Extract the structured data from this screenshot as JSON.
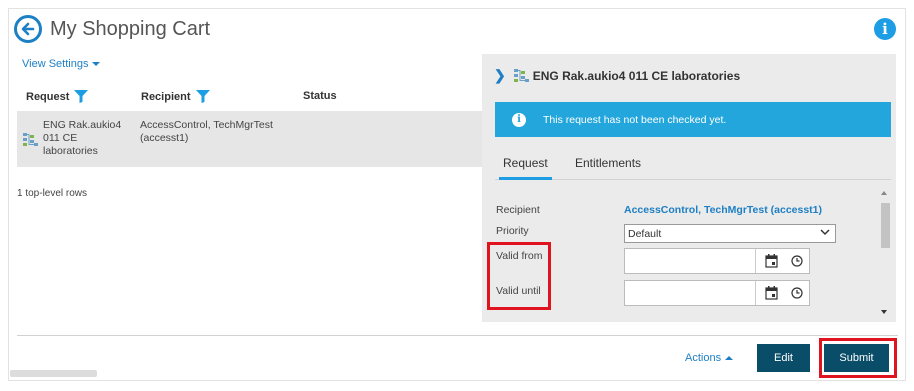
{
  "header": {
    "title": "My Shopping Cart"
  },
  "view_settings": {
    "label": "View Settings"
  },
  "table": {
    "columns": [
      "Request",
      "Recipient",
      "Status"
    ],
    "rows": [
      {
        "request": "ENG Rak.aukio4 011 CE laboratories",
        "recipient": "AccessControl, TechMgrTest (accesst1)",
        "status": ""
      }
    ],
    "row_count_text": "1 top-level rows"
  },
  "details": {
    "title": "ENG Rak.aukio4 011 CE laboratories",
    "notice": "This request has not been checked yet.",
    "tabs": [
      "Request",
      "Entitlements"
    ],
    "active_tab": "Request",
    "form": {
      "recipient_label": "Recipient",
      "recipient_value": "AccessControl, TechMgrTest (accesst1)",
      "priority_label": "Priority",
      "priority_value": "Default",
      "valid_from_label": "Valid from",
      "valid_from_value": "",
      "valid_until_label": "Valid until",
      "valid_until_value": ""
    }
  },
  "footer": {
    "actions_label": "Actions",
    "edit_label": "Edit",
    "submit_label": "Submit"
  },
  "colors": {
    "accent": "#1d7fc4",
    "notice_bg": "#23a6dc",
    "primary_button": "#0a4d68",
    "highlight_border": "#e0141e"
  },
  "icons": {
    "back": "arrow-left-circle-icon",
    "info": "info-icon",
    "filter": "funnel-icon",
    "item": "building-network-icon",
    "calendar": "calendar-icon",
    "clock": "clock-icon"
  }
}
